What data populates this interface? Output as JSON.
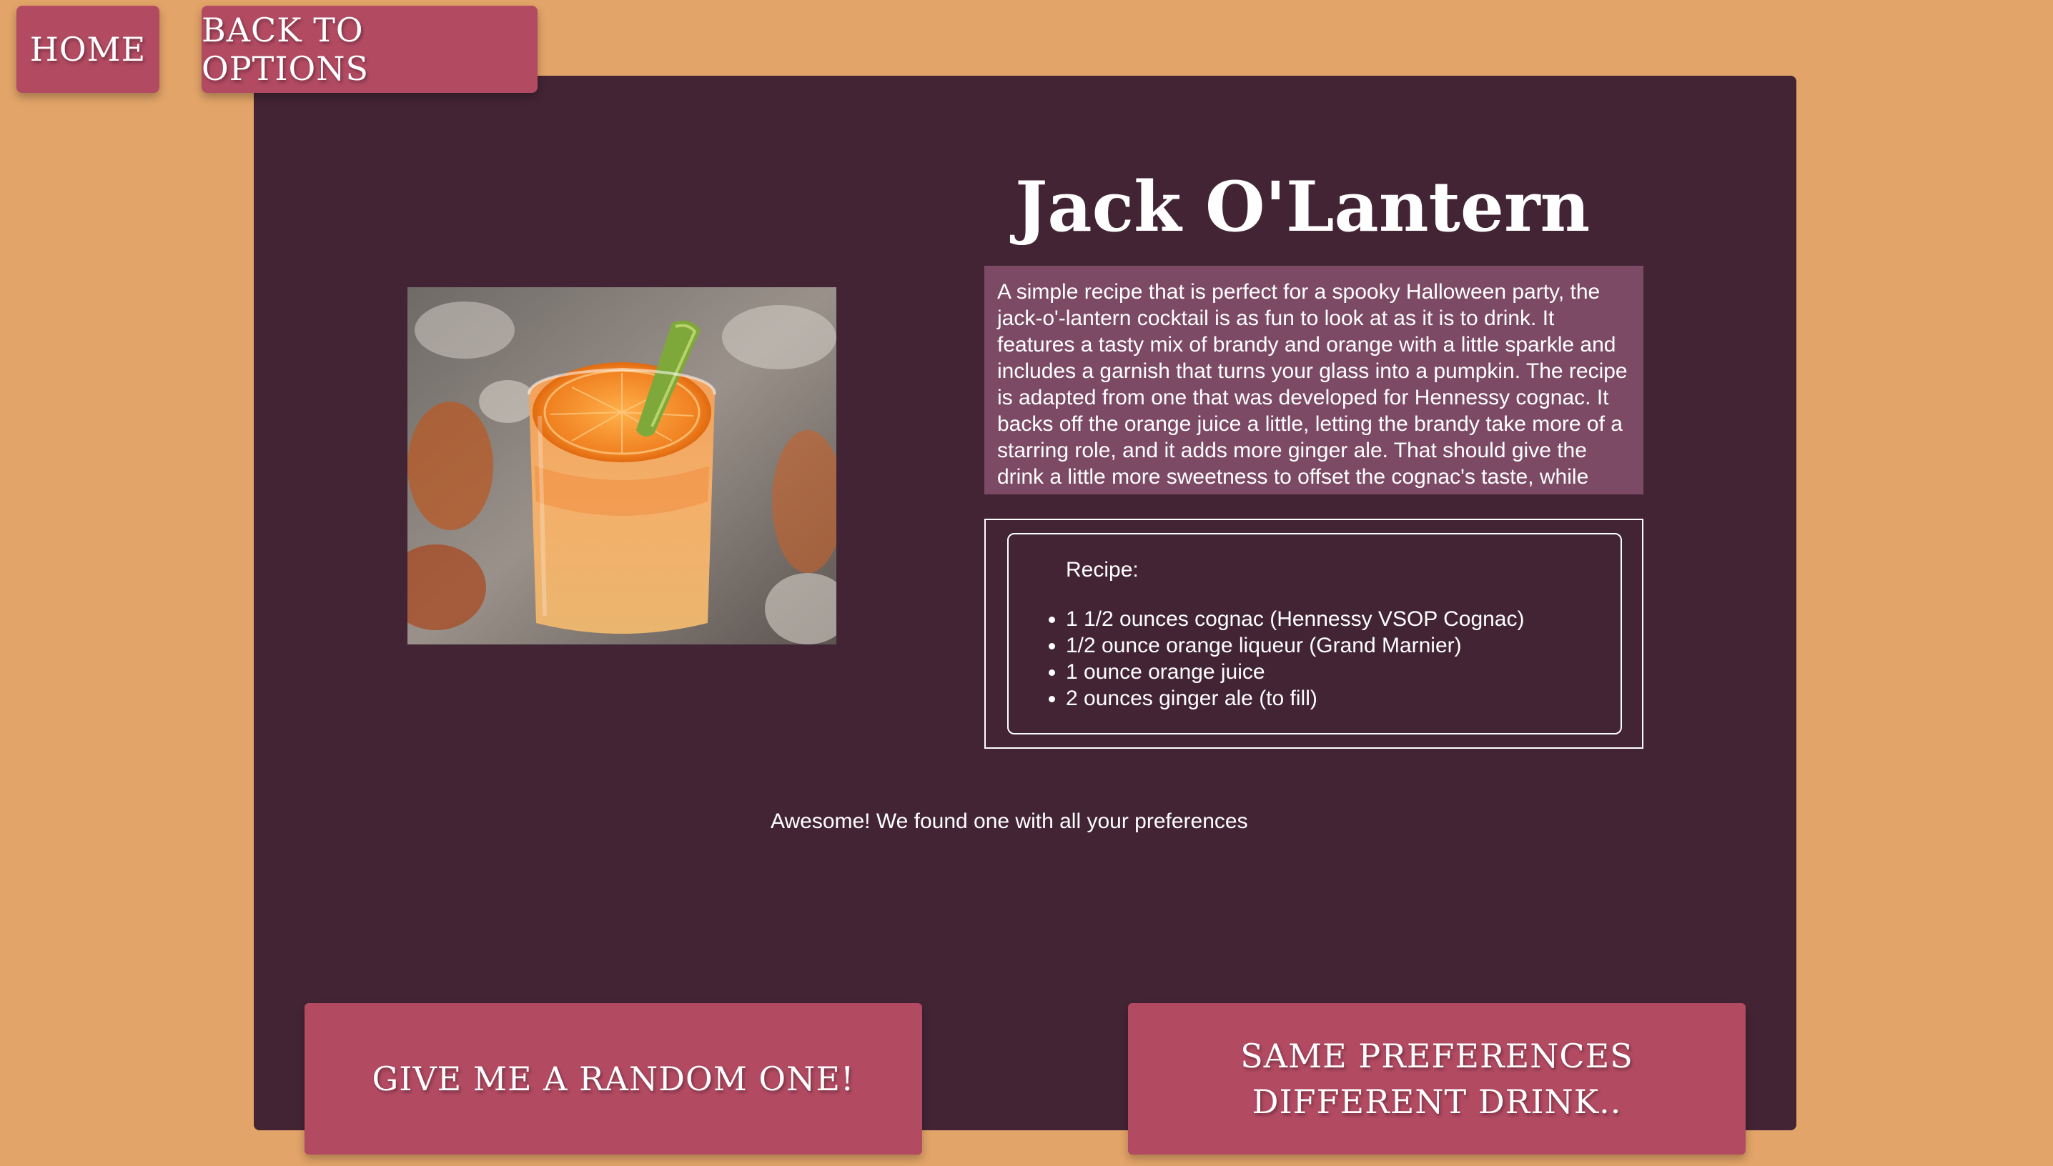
{
  "nav": {
    "home_label": "HOME",
    "back_label": "BACK TO OPTIONS"
  },
  "drink": {
    "title": "Jack O'Lantern",
    "image_alt": "Orange cocktail in a glass garnished with an orange slice and a lime peel stem, resembling a pumpkin",
    "description": "A simple recipe that is perfect for a spooky Halloween party, the jack-o'-lantern cocktail is as fun to look at as it is to drink. It features a tasty mix of brandy and orange with a little sparkle and includes a garnish that turns your glass into a pumpkin. The recipe is adapted from one that was developed for Hennessy cognac. It backs off the orange juice a little, letting the brandy take more of a starring role, and it adds more ginger ale. That should give the drink a little more sweetness to offset the cognac's taste, while making it more refreshing.",
    "recipe_heading": "Recipe:",
    "ingredients": [
      "1 1/2 ounces cognac (Hennessy VSOP Cognac)",
      "1/2 ounce orange liqueur (Grand Marnier)",
      "1 ounce orange juice",
      "2 ounces ginger ale (to fill)"
    ]
  },
  "status": {
    "message": "Awesome! We found one with all your preferences"
  },
  "actions": {
    "random_label": "GIVE ME A RANDOM ONE!",
    "same_pref_label": "SAME PREFERENCES DIFFERENT DRINK.."
  },
  "colors": {
    "page_background": "#e2a468",
    "card_background": "#432434",
    "button_background": "#b24a62",
    "description_background": "#7d4a66",
    "text": "#ffffff"
  }
}
